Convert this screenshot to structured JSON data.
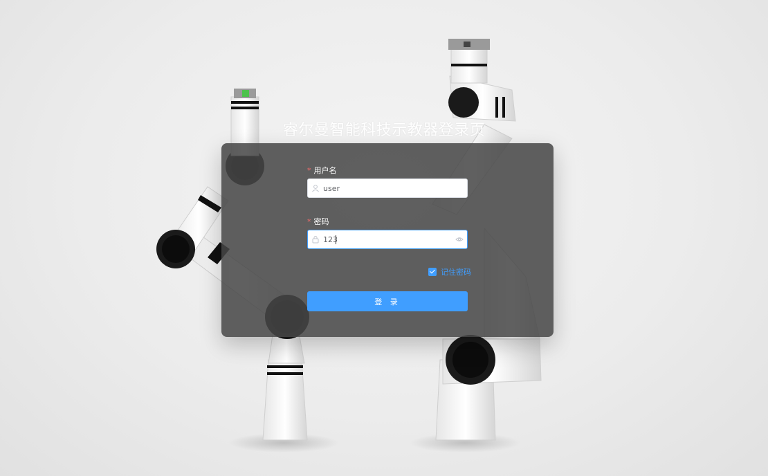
{
  "page": {
    "title": "睿尔曼智能科技示教器登录页"
  },
  "form": {
    "username": {
      "label": "用户名",
      "required_mark": "*",
      "value": "user",
      "icon": "user-icon"
    },
    "password": {
      "label": "密码",
      "required_mark": "*",
      "value": "123",
      "icon": "lock-icon",
      "toggle_icon": "eye-icon"
    },
    "remember": {
      "label": "记住密码",
      "checked": true
    },
    "login_button": "登 录"
  },
  "colors": {
    "accent": "#409eff",
    "panel": "#464646",
    "required": "#f56c6c"
  }
}
